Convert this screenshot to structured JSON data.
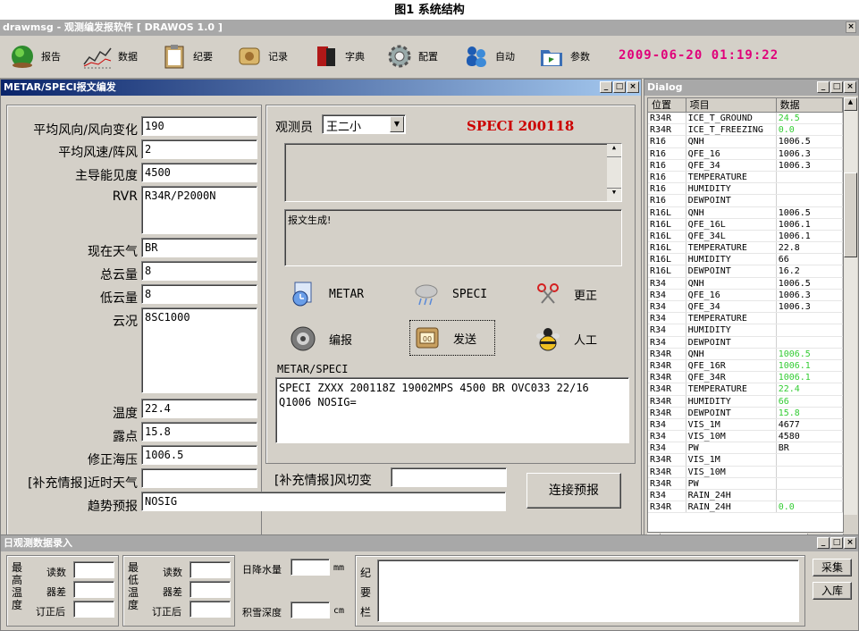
{
  "caption": "图1 系统结构",
  "app": {
    "title": "drawmsg - 观测编发报软件 [ DRAWOS 1.0 ]",
    "close": "×"
  },
  "toolbar": {
    "items": [
      {
        "label": "报告",
        "icon": "globe-icon"
      },
      {
        "label": "数据",
        "icon": "line-chart-icon"
      },
      {
        "label": "纪要",
        "icon": "clipboard-icon"
      },
      {
        "label": "记录",
        "icon": "scroll-icon"
      },
      {
        "label": "字典",
        "icon": "book-icon"
      },
      {
        "label": "配置",
        "icon": "gear-icon"
      },
      {
        "label": "自动",
        "icon": "people-icon"
      },
      {
        "label": "参数",
        "icon": "folder-icon"
      }
    ],
    "datetime": "2009-06-20 01:19:22"
  },
  "metar_window": {
    "title": "METAR/SPECI报文编发",
    "fields": [
      {
        "label": "平均风向/风向变化",
        "value": "190"
      },
      {
        "label": "平均风速/阵风",
        "value": "2"
      },
      {
        "label": "主导能见度",
        "value": "4500"
      },
      {
        "label": "RVR",
        "value": "R34R/P2000N"
      },
      {
        "label": "现在天气",
        "value": "BR"
      },
      {
        "label": "总云量",
        "value": "8"
      },
      {
        "label": "低云量",
        "value": "8"
      },
      {
        "label": "云况",
        "value": "8SC1000"
      },
      {
        "label": "温度",
        "value": "22.4"
      },
      {
        "label": "露点",
        "value": "15.8"
      },
      {
        "label": "修正海压",
        "value": "1006.5"
      },
      {
        "label": "[补充情报]近时天气",
        "value": ""
      },
      {
        "label": "趋势预报",
        "value": "NOSIG"
      }
    ],
    "wind_shear_label": "[补充情报]风切变",
    "wind_shear_value": "",
    "observer_label": "观测员",
    "observer_value": "王二小",
    "report_id": "SPECI 200118",
    "status_text": "报文生成!",
    "actions": [
      {
        "label": "METAR",
        "icon": "clock-doc-icon"
      },
      {
        "label": "SPECI",
        "icon": "cloud-rain-icon"
      },
      {
        "label": "更正",
        "icon": "scissors-icon"
      },
      {
        "label": "编报",
        "icon": "disk-icon"
      },
      {
        "label": "发送",
        "icon": "send-icon"
      },
      {
        "label": "人工",
        "icon": "bee-icon"
      }
    ],
    "message_label": "METAR/SPECI",
    "message_text": "SPECI ZXXX 200118Z 19002MPS 4500 BR OVC033 22/16\nQ1006 NOSIG=",
    "connect_button": "连接预报"
  },
  "dialog": {
    "title": "Dialog",
    "columns": [
      "位置",
      "项目",
      "数据"
    ],
    "rows": [
      [
        "R34R",
        "ICE_T_GROUND",
        "24.5",
        "green"
      ],
      [
        "R34R",
        "ICE_T_FREEZING",
        "0.0",
        "green"
      ],
      [
        "R16",
        "QNH",
        "1006.5",
        ""
      ],
      [
        "R16",
        "QFE_16",
        "1006.3",
        ""
      ],
      [
        "R16",
        "QFE_34",
        "1006.3",
        ""
      ],
      [
        "R16",
        "TEMPERATURE",
        "",
        ""
      ],
      [
        "R16",
        "HUMIDITY",
        "",
        ""
      ],
      [
        "R16",
        "DEWPOINT",
        "",
        ""
      ],
      [
        "R16L",
        "QNH",
        "1006.5",
        ""
      ],
      [
        "R16L",
        "QFE_16L",
        "1006.1",
        ""
      ],
      [
        "R16L",
        "QFE_34L",
        "1006.1",
        ""
      ],
      [
        "R16L",
        "TEMPERATURE",
        "22.8",
        ""
      ],
      [
        "R16L",
        "HUMIDITY",
        "66",
        ""
      ],
      [
        "R16L",
        "DEWPOINT",
        "16.2",
        ""
      ],
      [
        "R34",
        "QNH",
        "1006.5",
        ""
      ],
      [
        "R34",
        "QFE_16",
        "1006.3",
        ""
      ],
      [
        "R34",
        "QFE_34",
        "1006.3",
        ""
      ],
      [
        "R34",
        "TEMPERATURE",
        "",
        ""
      ],
      [
        "R34",
        "HUMIDITY",
        "",
        ""
      ],
      [
        "R34",
        "DEWPOINT",
        "",
        ""
      ],
      [
        "R34R",
        "QNH",
        "1006.5",
        "green"
      ],
      [
        "R34R",
        "QFE_16R",
        "1006.1",
        "green"
      ],
      [
        "R34R",
        "QFE_34R",
        "1006.1",
        "green"
      ],
      [
        "R34R",
        "TEMPERATURE",
        "22.4",
        "green"
      ],
      [
        "R34R",
        "HUMIDITY",
        "66",
        "green"
      ],
      [
        "R34R",
        "DEWPOINT",
        "15.8",
        "green"
      ],
      [
        "R34",
        "VIS_1M",
        "4677",
        ""
      ],
      [
        "R34",
        "VIS_10M",
        "4580",
        ""
      ],
      [
        "R34",
        "PW",
        "BR",
        ""
      ],
      [
        "R34R",
        "VIS_1M",
        "",
        ""
      ],
      [
        "R34R",
        "VIS_10M",
        "",
        ""
      ],
      [
        "R34R",
        "PW",
        "",
        ""
      ],
      [
        "R34",
        "RAIN_24H",
        "",
        ""
      ],
      [
        "R34R",
        "RAIN_24H",
        "0.0",
        "green"
      ]
    ],
    "green_color": "#33cc33"
  },
  "obs_window": {
    "title": "日观测数据录入",
    "max_temp_label": "最高温度",
    "min_temp_label": "最低温度",
    "reading": "读数",
    "error": "器差",
    "corrected": "订正后",
    "rain_label": "日降水量",
    "rain_unit": "mm",
    "snow_label": "积雪深度",
    "snow_unit": "cm",
    "summary_label": "纪要栏",
    "collect_button": "采集",
    "store_button": "入库"
  },
  "colors": {
    "accent_datetime": "#e0007a",
    "report_id": "#cc0000",
    "active_title": "#0a246a",
    "inactive_title": "#a8a8a8"
  }
}
